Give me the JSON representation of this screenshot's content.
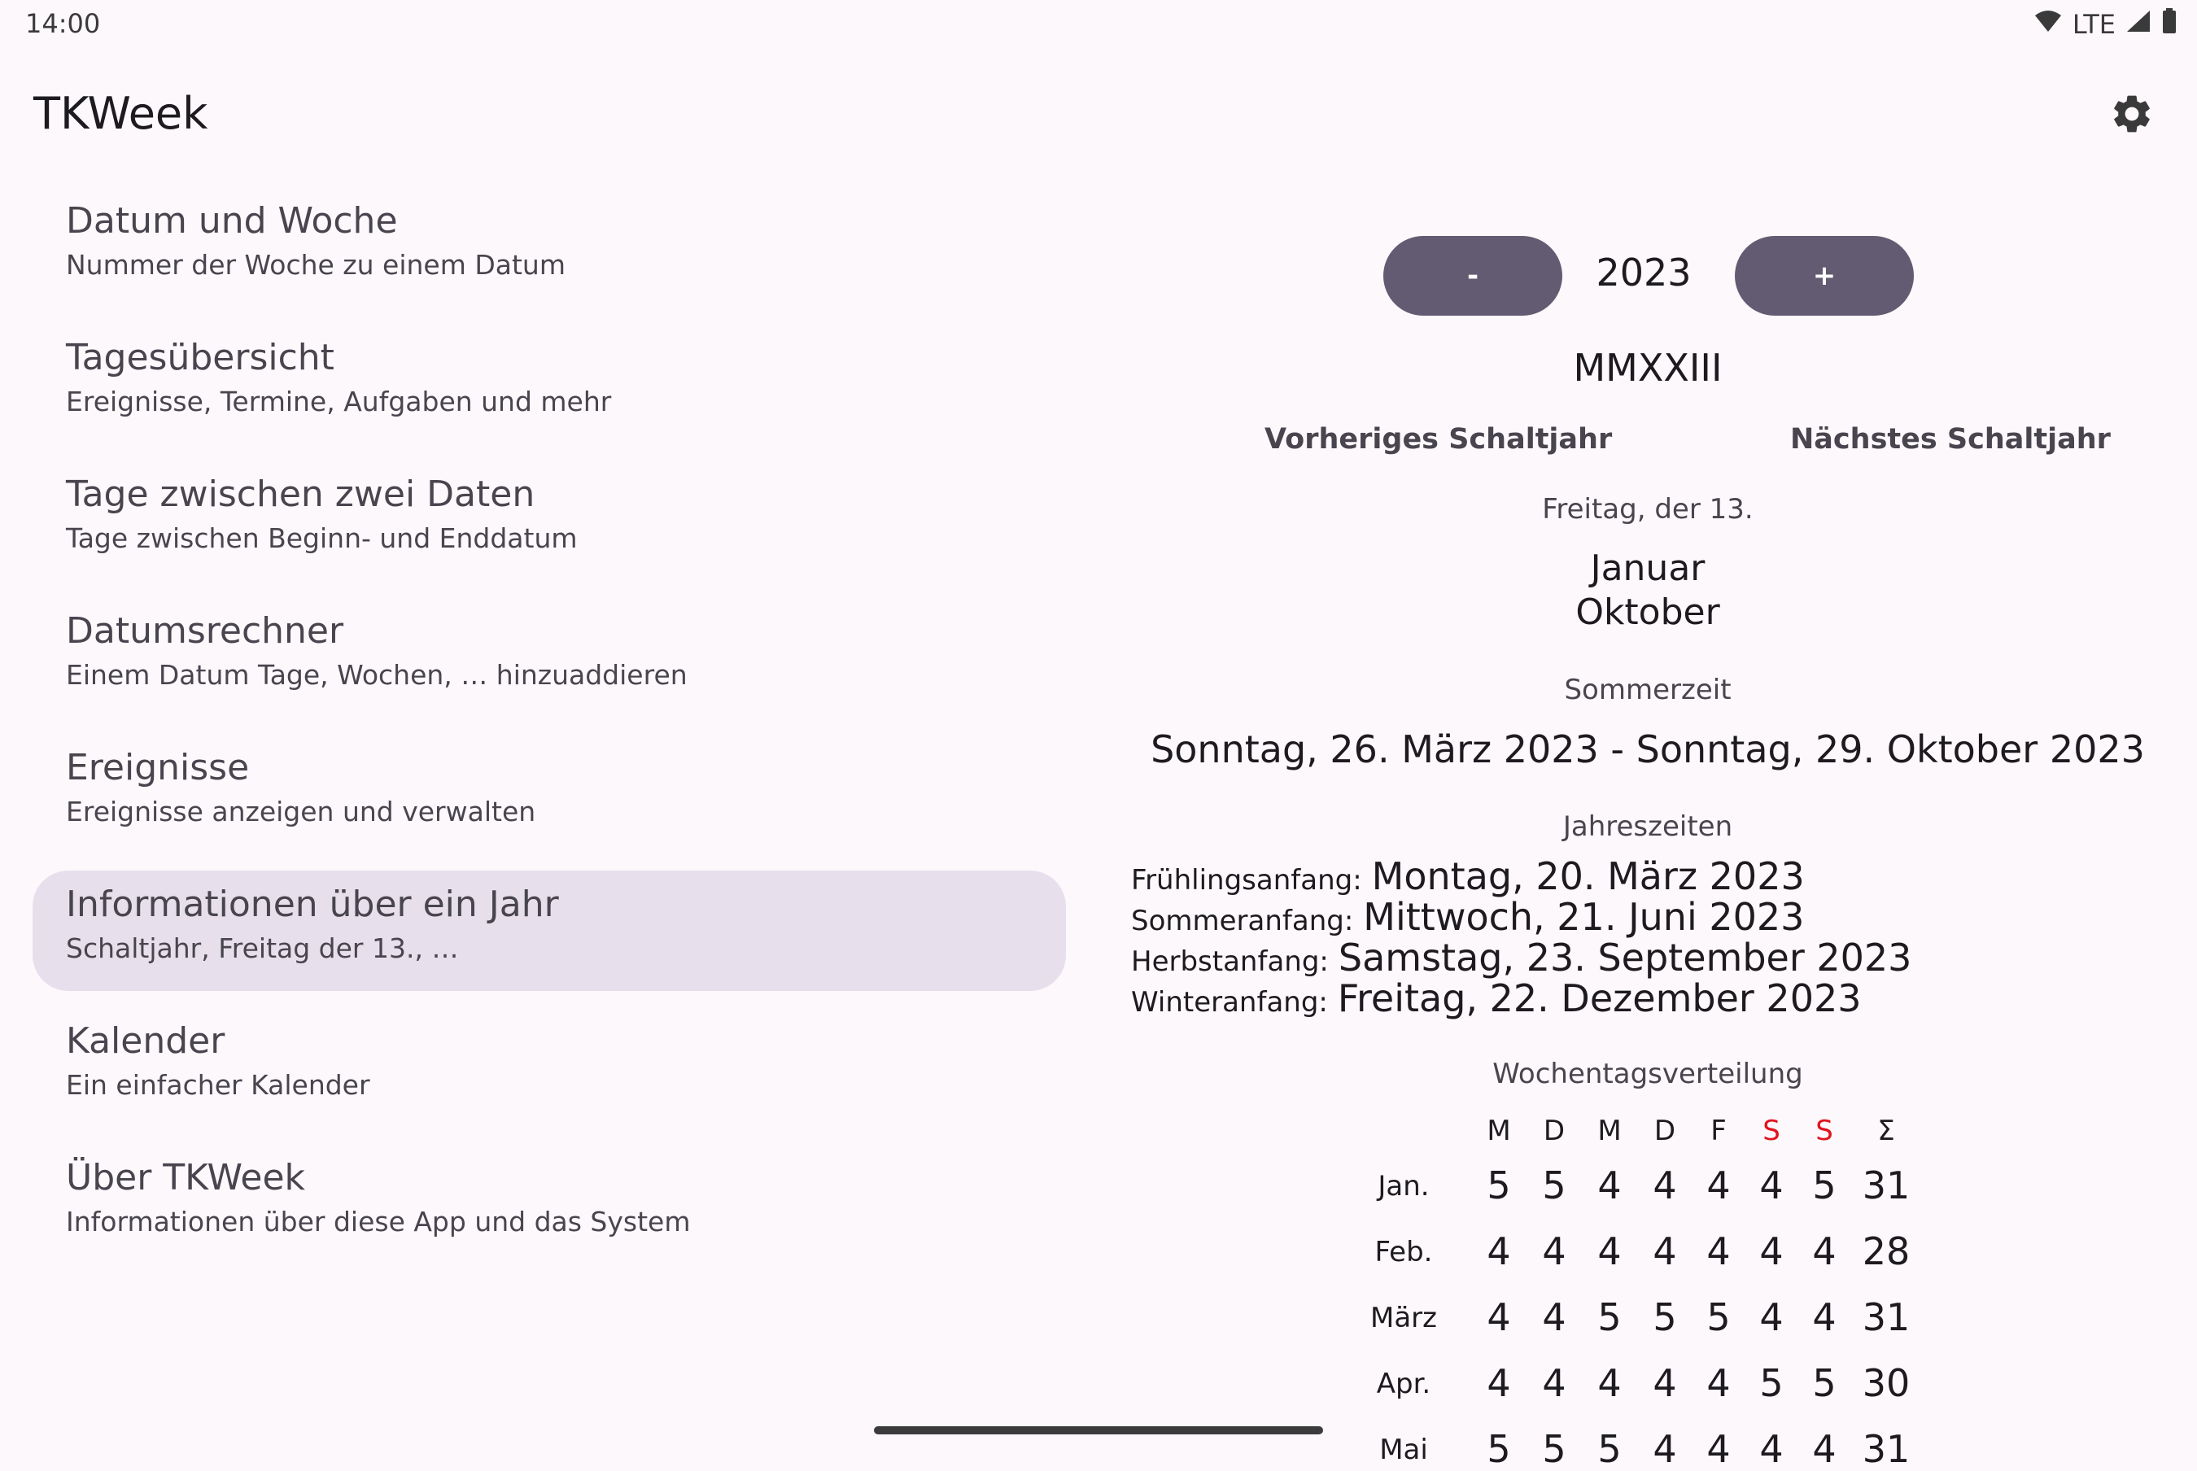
{
  "status": {
    "time": "14:00",
    "network": "LTE",
    "icons": [
      "wifi-icon",
      "signal-icon",
      "battery-icon"
    ]
  },
  "app": {
    "title": "TKWeek",
    "settings_icon": "gear-icon"
  },
  "nav": {
    "items": [
      {
        "title": "Datum und Woche",
        "subtitle": "Nummer der Woche zu einem Datum"
      },
      {
        "title": "Tagesübersicht",
        "subtitle": "Ereignisse, Termine, Aufgaben und mehr"
      },
      {
        "title": "Tage zwischen zwei Daten",
        "subtitle": "Tage zwischen Beginn- und Enddatum"
      },
      {
        "title": "Datumsrechner",
        "subtitle": "Einem Datum Tage, Wochen, … hinzuaddieren"
      },
      {
        "title": "Ereignisse",
        "subtitle": "Ereignisse anzeigen und verwalten"
      },
      {
        "title": "Informationen über ein Jahr",
        "subtitle": "Schaltjahr, Freitag der 13., …",
        "selected": true
      },
      {
        "title": "Kalender",
        "subtitle": "Ein einfacher Kalender"
      },
      {
        "title": "Über TKWeek",
        "subtitle": "Informationen über diese App und das System"
      }
    ]
  },
  "year": {
    "minus_label": "-",
    "plus_label": "+",
    "value": "2023",
    "roman": "MMXXIII",
    "prev_leap": "Vorheriges Schaltjahr",
    "next_leap": "Nächstes Schaltjahr",
    "friday13_label": "Freitag, der 13.",
    "friday13_months": [
      "Januar",
      "Oktober"
    ],
    "dst_label": "Sommerzeit",
    "dst_range": "Sonntag, 26. März 2023 - Sonntag, 29. Oktober 2023",
    "seasons_label": "Jahreszeiten",
    "seasons": [
      {
        "label": "Frühlingsanfang:",
        "value": "Montag, 20. März 2023"
      },
      {
        "label": "Sommeranfang:",
        "value": "Mittwoch, 21. Juni 2023"
      },
      {
        "label": "Herbstanfang:",
        "value": "Samstag, 23. September 2023"
      },
      {
        "label": "Winteranfang:",
        "value": "Freitag, 22. Dezember 2023"
      }
    ],
    "weekday_label": "Wochentagsverteilung",
    "weekday_headers": [
      "M",
      "D",
      "M",
      "D",
      "F",
      "S",
      "S",
      "Σ"
    ],
    "weekday_weekend_color": "#e0141e",
    "weekday_rows": [
      {
        "month": "Jan.",
        "values": [
          "5",
          "5",
          "4",
          "4",
          "4",
          "4",
          "5",
          "31"
        ]
      },
      {
        "month": "Feb.",
        "values": [
          "4",
          "4",
          "4",
          "4",
          "4",
          "4",
          "4",
          "28"
        ]
      },
      {
        "month": "März",
        "values": [
          "4",
          "4",
          "5",
          "5",
          "5",
          "4",
          "4",
          "31"
        ]
      },
      {
        "month": "Apr.",
        "values": [
          "4",
          "4",
          "4",
          "4",
          "4",
          "5",
          "5",
          "30"
        ]
      },
      {
        "month": "Mai",
        "values": [
          "5",
          "5",
          "5",
          "4",
          "4",
          "4",
          "4",
          "31"
        ]
      }
    ]
  },
  "colors": {
    "accent": "#625b71",
    "selected_bg": "#e7e0ec",
    "background": "#fdf8fc"
  }
}
